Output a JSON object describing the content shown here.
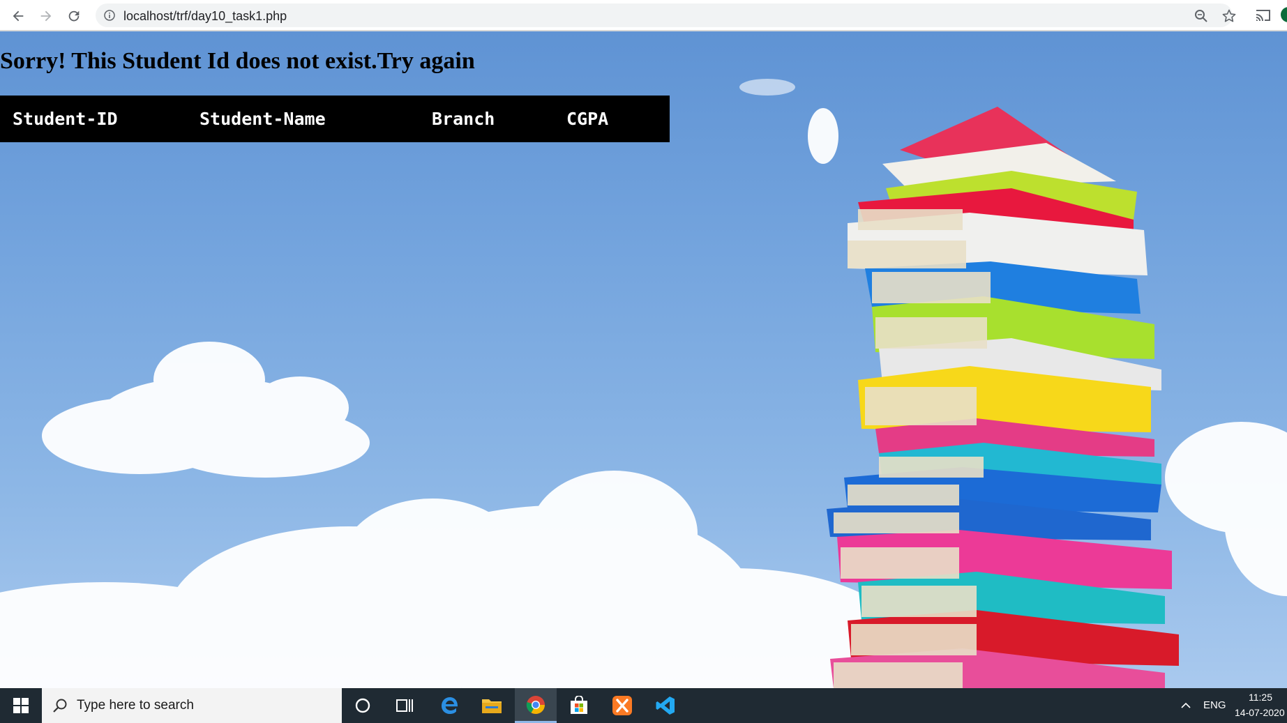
{
  "browser": {
    "url": "localhost/trf/day10_task1.php"
  },
  "page": {
    "message": "Sorry! This Student Id does not exist.Try again",
    "table": {
      "headers": [
        "Student-ID",
        "Student-Name",
        "Branch",
        "CGPA"
      ]
    }
  },
  "taskbar": {
    "search_placeholder": "Type here to search",
    "pinned_apps": [
      "cortana",
      "task-view",
      "edge",
      "file-explorer",
      "chrome",
      "store",
      "xampp",
      "vscode"
    ],
    "tray": {
      "language": "ENG",
      "time": "11:25",
      "date": "14-07-2020"
    }
  },
  "colors": {
    "table_bg": "#000000",
    "table_text": "#ffffff",
    "taskbar_bg": "#1f2a33"
  }
}
